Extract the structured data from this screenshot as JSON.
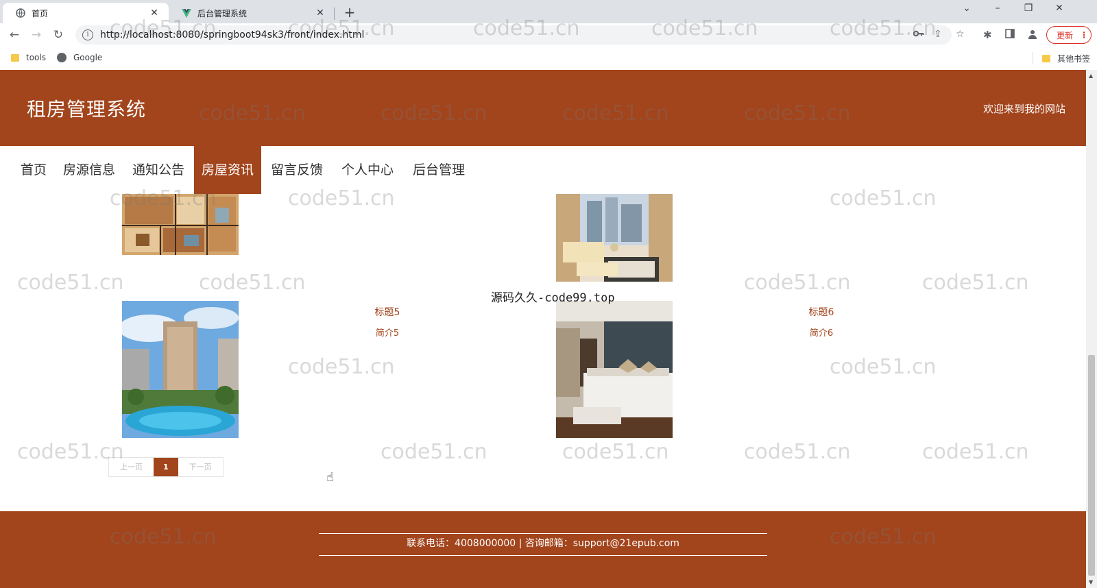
{
  "browser": {
    "tabs": [
      {
        "title": "首页",
        "close": "✕"
      },
      {
        "title": "后台管理系统",
        "close": "✕"
      }
    ],
    "new_tab": "+",
    "window_controls": {
      "dropdown": "⌄",
      "minimize": "–",
      "restore": "❐",
      "close": "✕"
    },
    "url": "http://localhost:8080/springboot94sk3/front/index.html",
    "update_button": "更新",
    "update_menu": "⋮",
    "bookmarks": [
      {
        "label": "tools",
        "icon": "folder-icon"
      },
      {
        "label": "Google",
        "icon": "globe-icon"
      }
    ],
    "other_bookmarks": "其他书签"
  },
  "site": {
    "title": "租房管理系统",
    "welcome": "欢迎来到我的网站",
    "accent_color": "#a2441c",
    "nav": [
      "首页",
      "房源信息",
      "通知公告",
      "房屋资讯",
      "留言反馈",
      "个人中心",
      "后台管理"
    ],
    "active_nav": "房屋资讯"
  },
  "news_cards": [
    {
      "title": "",
      "intro": "",
      "image": "floor-plan"
    },
    {
      "title": "",
      "intro": "",
      "image": "living-room"
    },
    {
      "title": "标题5",
      "intro": "简介5",
      "image": "apartment-building"
    },
    {
      "title": "标题6",
      "intro": "简介6",
      "image": "bedroom"
    }
  ],
  "source_note": "源码久久-code99.top",
  "pagination": {
    "prev": "上一页",
    "current": "1",
    "next": "下一页"
  },
  "footer": {
    "text": "联系电话：4008000000 | 咨询邮箱：support@21epub.com"
  },
  "watermark": "code51.cn"
}
